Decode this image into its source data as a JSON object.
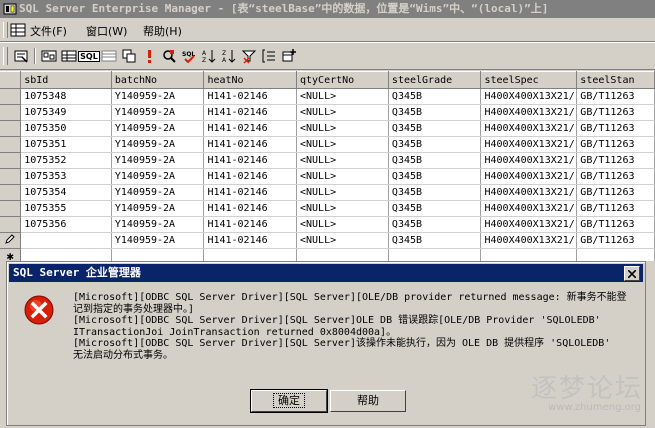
{
  "window": {
    "title": "SQL Server Enterprise Manager - [表“steelBase”中的数据，位置是“Wims”中、“(local)”上]"
  },
  "menu": [
    "文件(F)",
    "窗口(W)",
    "帮助(H)"
  ],
  "toolbar": {
    "buttons": [
      "properties-icon",
      "show-diagram-pane-icon",
      "show-grid-pane-icon",
      "show-sql-pane-icon",
      "show-results-pane-icon",
      "change-type-icon",
      "run-icon",
      "verify-sql-icon",
      "sort-ascending-icon",
      "sort-descending-icon",
      "remove-filter-icon",
      "group-by-icon",
      "add-table-icon"
    ],
    "sql_label": "SQL"
  },
  "grid": {
    "columns": [
      "sbId",
      "batchNo",
      "heatNo",
      "qtyCertNo",
      "steelGrade",
      "steelSpec",
      "steelStan"
    ],
    "rows": [
      [
        "1075348",
        "Y140959-2A",
        "H141-02146",
        "<NULL>",
        "Q345B",
        "H400X400X13X21/",
        "GB/T11263"
      ],
      [
        "1075349",
        "Y140959-2A",
        "H141-02146",
        "<NULL>",
        "Q345B",
        "H400X400X13X21/",
        "GB/T11263"
      ],
      [
        "1075350",
        "Y140959-2A",
        "H141-02146",
        "<NULL>",
        "Q345B",
        "H400X400X13X21/",
        "GB/T11263"
      ],
      [
        "1075351",
        "Y140959-2A",
        "H141-02146",
        "<NULL>",
        "Q345B",
        "H400X400X13X21/",
        "GB/T11263"
      ],
      [
        "1075352",
        "Y140959-2A",
        "H141-02146",
        "<NULL>",
        "Q345B",
        "H400X400X13X21/",
        "GB/T11263"
      ],
      [
        "1075353",
        "Y140959-2A",
        "H141-02146",
        "<NULL>",
        "Q345B",
        "H400X400X13X21/",
        "GB/T11263"
      ],
      [
        "1075354",
        "Y140959-2A",
        "H141-02146",
        "<NULL>",
        "Q345B",
        "H400X400X13X21/",
        "GB/T11263"
      ],
      [
        "1075355",
        "Y140959-2A",
        "H141-02146",
        "<NULL>",
        "Q345B",
        "H400X400X13X21/",
        "GB/T11263"
      ],
      [
        "1075356",
        "Y140959-2A",
        "H141-02146",
        "<NULL>",
        "Q345B",
        "H400X400X13X21/",
        "GB/T11263"
      ],
      [
        "",
        "Y140959-2A",
        "H141-02146",
        "<NULL>",
        "Q345B",
        "H400X400X13X21/",
        "GB/T11263"
      ],
      [
        "",
        "",
        "",
        "",
        "",
        "",
        ""
      ]
    ]
  },
  "dialog": {
    "title": "SQL Server 企业管理器",
    "message_lines": [
      "[Microsoft][ODBC SQL Server Driver][SQL Server][OLE/DB provider returned message: 新事务不能登",
      "记到指定的事务处理器中。]",
      "[Microsoft][ODBC SQL Server Driver][SQL Server]OLE DB 错误跟踪[OLE/DB Provider 'SQLOLEDB'",
      "ITransactionJoi JoinTransaction returned 0x8004d00a]。",
      "[Microsoft][ODBC SQL Server Driver][SQL Server]该操作未能执行，因为 OLE DB 提供程序 'SQLOLEDB'",
      "无法启动分布式事务。"
    ],
    "ok_label": "确定",
    "help_label": "帮助"
  },
  "watermark": {
    "main": "逐梦论坛",
    "sub": "www.zhumeng.org"
  },
  "colors": {
    "dialog_title_bg": "#0a246a",
    "window_title_bg": "#808080",
    "error_red": "#d81e06"
  }
}
